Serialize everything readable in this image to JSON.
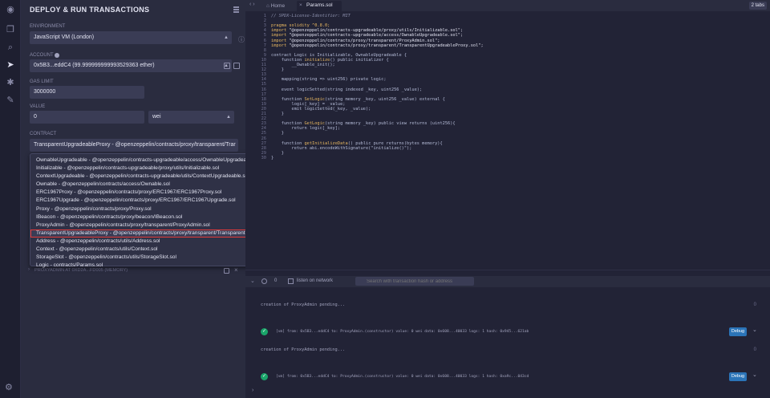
{
  "panel": {
    "title": "DEPLOY & RUN TRANSACTIONS",
    "environment_label": "ENVIRONMENT",
    "environment_value": "JavaScript VM (London)",
    "account_label": "ACCOUNT",
    "account_value": "0x5B3...eddC4 (99.999999999993529363 ether)",
    "gas_limit_label": "GAS LIMIT",
    "gas_limit_value": "3000000",
    "value_label": "VALUE",
    "value_amount": "0",
    "value_unit": "wei",
    "contract_label": "CONTRACT",
    "contract_value": "TransparentUpgradeableProxy - @openzeppelin/contracts/proxy/transparent/Trar",
    "contract_options": [
      "OwnableUpgradeable - @openzeppelin/contracts-upgradeable/access/OwnableUpgradeable.sol",
      "Initializable - @openzeppelin/contracts-upgradeable/proxy/utils/Initializable.sol",
      "ContextUpgradeable - @openzeppelin/contracts-upgradeable/utils/ContextUpgradeable.sol",
      "Ownable - @openzeppelin/contracts/access/Ownable.sol",
      "ERC1967Proxy - @openzeppelin/contracts/proxy/ERC1967/ERC1967Proxy.sol",
      "ERC1967Upgrade - @openzeppelin/contracts/proxy/ERC1967/ERC1967Upgrade.sol",
      "Proxy - @openzeppelin/contracts/proxy/Proxy.sol",
      "IBeacon - @openzeppelin/contracts/proxy/beacon/IBeacon.sol",
      "ProxyAdmin - @openzeppelin/contracts/proxy/transparent/ProxyAdmin.sol",
      "TransparentUpgradeableProxy - @openzeppelin/contracts/proxy/transparent/TransparentUpgradeableProxy.sol",
      "Address - @openzeppelin/contracts/utils/Address.sol",
      "Context - @openzeppelin/contracts/utils/Context.sol",
      "StorageSlot - @openzeppelin/contracts/utils/StorageSlot.sol",
      "Logic - contracts/Params.sol"
    ],
    "selected_index": 9,
    "deployed_instance": "PROXYADMIN AT 0XD2A...FD005 (MEMORY)"
  },
  "tabs": {
    "home": "Home",
    "active": "Params.sol",
    "count": "2 tabs"
  },
  "code_lines": [
    {
      "n": "1",
      "parts": [
        {
          "t": "// SPDX-License-Identifier: MIT",
          "c": "cm"
        }
      ]
    },
    {
      "n": "2",
      "parts": []
    },
    {
      "n": "3",
      "parts": [
        {
          "t": "pragma solidity ",
          "c": "kw"
        },
        {
          "t": "^0.8.0;",
          "c": "kw"
        }
      ]
    },
    {
      "n": "4",
      "parts": [
        {
          "t": "import ",
          "c": "kw"
        },
        {
          "t": "\"@openzeppelin/contracts-upgradeable/proxy/utils/Initializable.sol\";",
          "c": "str"
        }
      ]
    },
    {
      "n": "5",
      "parts": [
        {
          "t": "import ",
          "c": "kw"
        },
        {
          "t": "\"@openzeppelin/contracts-upgradeable/access/OwnableUpgradeable.sol\";",
          "c": "str"
        }
      ]
    },
    {
      "n": "6",
      "parts": [
        {
          "t": "import ",
          "c": "kw"
        },
        {
          "t": "\"@openzeppelin/contracts/proxy/transparent/ProxyAdmin.sol\";",
          "c": "str"
        }
      ]
    },
    {
      "n": "7",
      "parts": [
        {
          "t": "import ",
          "c": "kw"
        },
        {
          "t": "\"@openzeppelin/contracts/proxy/transparent/TransparentUpgradeableProxy.sol\";",
          "c": "str"
        }
      ]
    },
    {
      "n": "8",
      "parts": []
    },
    {
      "n": "9",
      "parts": [
        {
          "t": "contract Logic is Initializable, OwnableUpgradeable {",
          "c": ""
        }
      ]
    },
    {
      "n": "10",
      "parts": [
        {
          "t": "    function ",
          "c": ""
        },
        {
          "t": "initialize",
          "c": "kw"
        },
        {
          "t": "() public initializer {",
          "c": ""
        }
      ]
    },
    {
      "n": "11",
      "parts": [
        {
          "t": "        __Ownable_init();",
          "c": ""
        }
      ]
    },
    {
      "n": "12",
      "parts": [
        {
          "t": "    }",
          "c": ""
        }
      ]
    },
    {
      "n": "13",
      "parts": []
    },
    {
      "n": "14",
      "parts": [
        {
          "t": "    mapping(string => uint256) private logic;",
          "c": ""
        }
      ]
    },
    {
      "n": "15",
      "parts": []
    },
    {
      "n": "16",
      "parts": [
        {
          "t": "    event logicSetted(string indexed _key, uint256 _value);",
          "c": ""
        }
      ]
    },
    {
      "n": "17",
      "parts": []
    },
    {
      "n": "18",
      "parts": [
        {
          "t": "    function ",
          "c": ""
        },
        {
          "t": "SetLogic",
          "c": "kw"
        },
        {
          "t": "(string memory _key, uint256 _value) external {",
          "c": ""
        }
      ]
    },
    {
      "n": "19",
      "parts": [
        {
          "t": "        logic[_key] = _value;",
          "c": ""
        }
      ]
    },
    {
      "n": "20",
      "parts": [
        {
          "t": "        emit logicSetted(_key, _value);",
          "c": ""
        }
      ]
    },
    {
      "n": "21",
      "parts": [
        {
          "t": "    }",
          "c": ""
        }
      ]
    },
    {
      "n": "22",
      "parts": []
    },
    {
      "n": "23",
      "parts": [
        {
          "t": "    function ",
          "c": ""
        },
        {
          "t": "GetLogic",
          "c": "kw"
        },
        {
          "t": "(string memory _key) public view returns (uint256){",
          "c": ""
        }
      ]
    },
    {
      "n": "24",
      "parts": [
        {
          "t": "        return logic[_key];",
          "c": ""
        }
      ]
    },
    {
      "n": "25",
      "parts": [
        {
          "t": "    }",
          "c": ""
        }
      ]
    },
    {
      "n": "26",
      "parts": []
    },
    {
      "n": "27",
      "parts": [
        {
          "t": "    function ",
          "c": ""
        },
        {
          "t": "getInitializeData",
          "c": "kw"
        },
        {
          "t": "() public pure returns(bytes memory){",
          "c": ""
        }
      ]
    },
    {
      "n": "28",
      "parts": [
        {
          "t": "        return abi.encodeWithSignature(\"initialize()\");",
          "c": ""
        }
      ]
    },
    {
      "n": "29",
      "parts": [
        {
          "t": "    }",
          "c": ""
        }
      ]
    },
    {
      "n": "30",
      "parts": [
        {
          "t": "}",
          "c": ""
        }
      ]
    }
  ],
  "terminal": {
    "count": "0",
    "listen_label": "listen on network",
    "search_placeholder": "Search with transaction hash or address",
    "logs": [
      {
        "kind": "text",
        "text": "creation of ProxyAdmin pending...",
        "zero": "0"
      },
      {
        "kind": "tx",
        "text": "[vm] from: 0x5B3...eddC4 to: ProxyAdmin.(constructor) value: 0 wei data: 0x608...40033 logs: 1 hash: 0x945...621ab",
        "debug": "Debug"
      },
      {
        "kind": "text",
        "text": "creation of ProxyAdmin pending...",
        "zero": "0"
      },
      {
        "kind": "tx",
        "text": "[vm] from: 0x5B3...eddC4 to: ProxyAdmin.(constructor) value: 0 wei data: 0x608...40033 logs: 1 hash: 0xa9c...043cd",
        "debug": "Debug"
      }
    ]
  }
}
